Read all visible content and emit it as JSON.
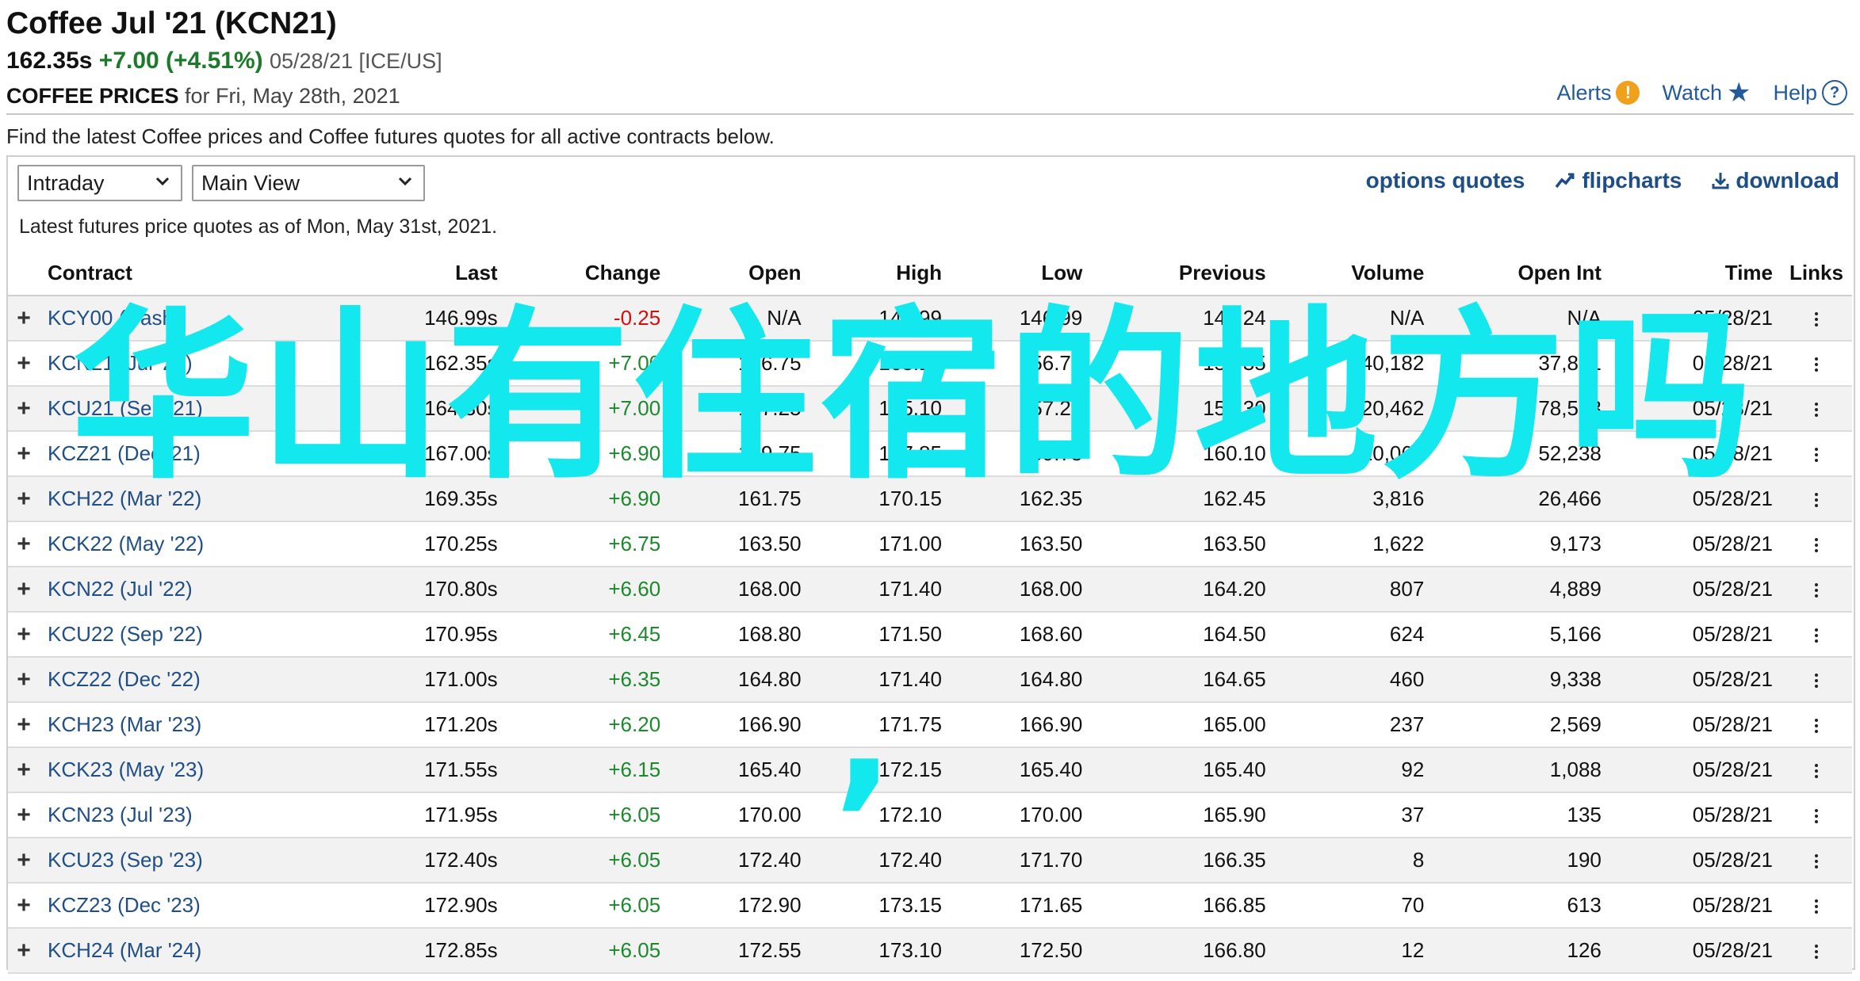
{
  "header": {
    "title": "Coffee Jul '21 (KCN21)",
    "last": "162.35s",
    "change": "+7.00 (+4.51%)",
    "meta": "05/28/21 [ICE/US]",
    "sub_bold": "COFFEE PRICES",
    "sub_rest": " for Fri, May 28th, 2021",
    "links": {
      "alerts": "Alerts",
      "watch": "Watch",
      "help": "Help"
    }
  },
  "intro": "Find the latest Coffee prices and Coffee futures quotes for all active contracts below.",
  "controls": {
    "period": "Intraday",
    "view": "Main View",
    "options_quotes": "options quotes",
    "flipcharts": "flipcharts",
    "download": "download"
  },
  "asof": "Latest futures price quotes as of Mon, May 31st, 2021.",
  "table": {
    "headers": [
      "Contract",
      "Last",
      "Change",
      "Open",
      "High",
      "Low",
      "Previous",
      "Volume",
      "Open Int",
      "Time",
      "Links"
    ],
    "rows": [
      [
        "KCY00 (Cash)",
        "146.99s",
        "-0.25",
        "N/A",
        "146.99",
        "146.99",
        "147.24",
        "N/A",
        "N/A",
        "05/28/21"
      ],
      [
        "KCN21 (Jul '21)",
        "162.35s",
        "+7.00",
        "156.75",
        "163.15",
        "156.75",
        "155.35",
        "40,182",
        "37,881",
        "05/28/21"
      ],
      [
        "KCU21 (Sep '21)",
        "164.30s",
        "+7.00",
        "157.25",
        "165.10",
        "157.25",
        "157.30",
        "20,462",
        "78,563",
        "05/28/21"
      ],
      [
        "KCZ21 (Dec '21)",
        "167.00s",
        "+6.90",
        "159.75",
        "167.85",
        "159.75",
        "160.10",
        "10,066",
        "52,238",
        "05/28/21"
      ],
      [
        "KCH22 (Mar '22)",
        "169.35s",
        "+6.90",
        "161.75",
        "170.15",
        "162.35",
        "162.45",
        "3,816",
        "26,466",
        "05/28/21"
      ],
      [
        "KCK22 (May '22)",
        "170.25s",
        "+6.75",
        "163.50",
        "171.00",
        "163.50",
        "163.50",
        "1,622",
        "9,173",
        "05/28/21"
      ],
      [
        "KCN22 (Jul '22)",
        "170.80s",
        "+6.60",
        "168.00",
        "171.40",
        "168.00",
        "164.20",
        "807",
        "4,889",
        "05/28/21"
      ],
      [
        "KCU22 (Sep '22)",
        "170.95s",
        "+6.45",
        "168.80",
        "171.50",
        "168.60",
        "164.50",
        "624",
        "5,166",
        "05/28/21"
      ],
      [
        "KCZ22 (Dec '22)",
        "171.00s",
        "+6.35",
        "164.80",
        "171.40",
        "164.80",
        "164.65",
        "460",
        "9,338",
        "05/28/21"
      ],
      [
        "KCH23 (Mar '23)",
        "171.20s",
        "+6.20",
        "166.90",
        "171.75",
        "166.90",
        "165.00",
        "237",
        "2,569",
        "05/28/21"
      ],
      [
        "KCK23 (May '23)",
        "171.55s",
        "+6.15",
        "165.40",
        "172.15",
        "165.40",
        "165.40",
        "92",
        "1,088",
        "05/28/21"
      ],
      [
        "KCN23 (Jul '23)",
        "171.95s",
        "+6.05",
        "170.00",
        "172.10",
        "170.00",
        "165.90",
        "37",
        "135",
        "05/28/21"
      ],
      [
        "KCU23 (Sep '23)",
        "172.40s",
        "+6.05",
        "172.40",
        "172.40",
        "171.70",
        "166.35",
        "8",
        "190",
        "05/28/21"
      ],
      [
        "KCZ23 (Dec '23)",
        "172.90s",
        "+6.05",
        "172.90",
        "173.15",
        "171.65",
        "166.85",
        "70",
        "613",
        "05/28/21"
      ],
      [
        "KCH24 (Mar '24)",
        "172.85s",
        "+6.05",
        "172.55",
        "173.10",
        "172.50",
        "166.80",
        "12",
        "126",
        "05/28/21"
      ]
    ]
  },
  "overlay": {
    "text": "华山有住宿的地方吗",
    "comma": ","
  },
  "colors": {
    "link": "#235a9c",
    "positive": "#1c8a2c",
    "negative": "#d01010",
    "overlay": "#12e8ee"
  },
  "icons": [
    "alert-icon",
    "star-icon",
    "help-icon",
    "chevron-down-icon",
    "flipchart-icon",
    "download-icon",
    "plus-icon",
    "kebab-icon"
  ]
}
